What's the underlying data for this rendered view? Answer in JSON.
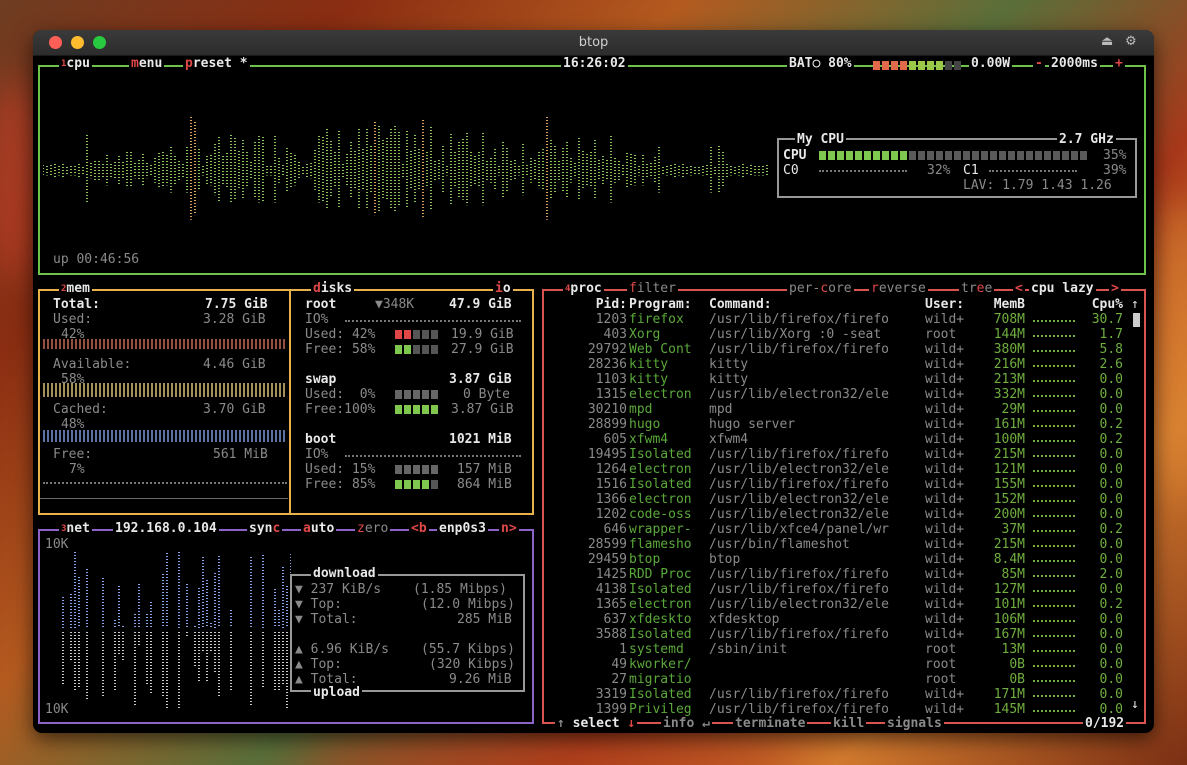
{
  "window": {
    "title": "btop"
  },
  "cpu": {
    "tab": "cpu",
    "tab_num": "1",
    "menu": "menu",
    "preset": "preset *",
    "clock": "16:26:02",
    "battery_label": "BAT○ 80%",
    "battery_level": 0.8,
    "power": "0.00W",
    "minus": "-",
    "interval": "2000ms",
    "plus": "+",
    "uptime": "up 00:46:56",
    "panel_title": "My CPU",
    "freq": "2.7 GHz",
    "total_label": "CPU",
    "total_pct": "35%",
    "total_level": 0.35,
    "c0_label": "C0",
    "c0_pct": "32%",
    "c1_label": "C1",
    "c1_pct": "39%",
    "lav": "LAV: 1.79 1.43 1.26"
  },
  "mem": {
    "tab": "mem",
    "tab_num": "2",
    "total_label": "Total:",
    "total": "7.75 GiB",
    "used_label": "Used:",
    "used": "3.28 GiB",
    "used_pct": "42%",
    "avail_label": "Available:",
    "avail": "4.46 GiB",
    "avail_pct": "58%",
    "cached_label": "Cached:",
    "cached": "3.70 GiB",
    "cached_pct": "48%",
    "free_label": "Free:",
    "free": "561 MiB",
    "free_pct": "7%"
  },
  "disks": {
    "tab": "disks",
    "io_tab": "io",
    "root": {
      "name": "root",
      "io": "▼348K",
      "size": "47.9 GiB",
      "io_label": "IO%",
      "used_label": "Used: 42%",
      "used": "19.9 GiB",
      "free_label": "Free: 58%",
      "free": "27.9 GiB"
    },
    "swap": {
      "name": "swap",
      "size": "3.87 GiB",
      "used_label": "Used:  0%",
      "used": "0 Byte",
      "free_label": "Free:100%",
      "free": "3.87 GiB"
    },
    "boot": {
      "name": "boot",
      "size": "1021 MiB",
      "io_label": "IO%",
      "used_label": "Used: 15%",
      "used": "157 MiB",
      "free_label": "Free: 85%",
      "free": "864 MiB"
    }
  },
  "net": {
    "tab": "net",
    "tab_num": "3",
    "ip": "192.168.0.104",
    "sync": "sync",
    "auto": "auto",
    "zero": "zero",
    "prev": "<b",
    "iface": "enp0s3",
    "next": "n>",
    "scale_top": "10K",
    "scale_bottom": "10K",
    "download": "download",
    "upload": "upload",
    "dl_rate": "▼ 237 KiB/s",
    "dl_rate_bits": "(1.85 Mibps)",
    "dl_top": "▼ Top:",
    "dl_top_val": "(12.0 Mibps)",
    "dl_total": "▼ Total:",
    "dl_total_val": "285 MiB",
    "ul_rate": "▲ 6.96 KiB/s",
    "ul_rate_bits": "(55.7 Kibps)",
    "ul_top": "▲ Top:",
    "ul_top_val": "(320 Kibps)",
    "ul_total": "▲ Total:",
    "ul_total_val": "9.26 MiB"
  },
  "proc": {
    "tab": "proc",
    "tab_num": "4",
    "filter": "filter",
    "per_core": "per-core",
    "reverse": "reverse",
    "tree": "tree",
    "sort_prev": "<",
    "sort": "cpu lazy",
    "sort_next": ">",
    "columns": {
      "pid": "Pid:",
      "program": "Program:",
      "command": "Command:",
      "user": "User:",
      "mem": "MemB",
      "cpu": "Cpu%"
    },
    "rows": [
      {
        "pid": "1203",
        "prog": "firefox",
        "cmd": "/usr/lib/firefox/firefo",
        "user": "wild+",
        "mem": "708M",
        "cpu": "30.7"
      },
      {
        "pid": "403",
        "prog": "Xorg",
        "cmd": "/usr/lib/Xorg :0 -seat",
        "user": "root",
        "mem": "144M",
        "cpu": "1.7"
      },
      {
        "pid": "29792",
        "prog": "Web Cont",
        "cmd": "/usr/lib/firefox/firefo",
        "user": "wild+",
        "mem": "380M",
        "cpu": "5.8"
      },
      {
        "pid": "28236",
        "prog": "kitty",
        "cmd": "kitty",
        "user": "wild+",
        "mem": "216M",
        "cpu": "2.6"
      },
      {
        "pid": "1103",
        "prog": "kitty",
        "cmd": "kitty",
        "user": "wild+",
        "mem": "213M",
        "cpu": "0.0"
      },
      {
        "pid": "1315",
        "prog": "electron",
        "cmd": "/usr/lib/electron32/ele",
        "user": "wild+",
        "mem": "332M",
        "cpu": "0.0"
      },
      {
        "pid": "30210",
        "prog": "mpd",
        "cmd": "mpd",
        "user": "wild+",
        "mem": "29M",
        "cpu": "0.0"
      },
      {
        "pid": "28899",
        "prog": "hugo",
        "cmd": "hugo server",
        "user": "wild+",
        "mem": "161M",
        "cpu": "0.2"
      },
      {
        "pid": "605",
        "prog": "xfwm4",
        "cmd": "xfwm4",
        "user": "wild+",
        "mem": "100M",
        "cpu": "0.2"
      },
      {
        "pid": "19495",
        "prog": "Isolated",
        "cmd": "/usr/lib/firefox/firefo",
        "user": "wild+",
        "mem": "215M",
        "cpu": "0.0"
      },
      {
        "pid": "1264",
        "prog": "electron",
        "cmd": "/usr/lib/electron32/ele",
        "user": "wild+",
        "mem": "121M",
        "cpu": "0.0"
      },
      {
        "pid": "1516",
        "prog": "Isolated",
        "cmd": "/usr/lib/firefox/firefo",
        "user": "wild+",
        "mem": "155M",
        "cpu": "0.0"
      },
      {
        "pid": "1366",
        "prog": "electron",
        "cmd": "/usr/lib/electron32/ele",
        "user": "wild+",
        "mem": "152M",
        "cpu": "0.0"
      },
      {
        "pid": "1202",
        "prog": "code-oss",
        "cmd": "/usr/lib/electron32/ele",
        "user": "wild+",
        "mem": "200M",
        "cpu": "0.0"
      },
      {
        "pid": "646",
        "prog": "wrapper-",
        "cmd": "/usr/lib/xfce4/panel/wr",
        "user": "wild+",
        "mem": "37M",
        "cpu": "0.2"
      },
      {
        "pid": "28599",
        "prog": "flamesho",
        "cmd": "/usr/bin/flameshot",
        "user": "wild+",
        "mem": "215M",
        "cpu": "0.0"
      },
      {
        "pid": "29459",
        "prog": "btop",
        "cmd": "btop",
        "user": "wild+",
        "mem": "8.4M",
        "cpu": "0.0"
      },
      {
        "pid": "1425",
        "prog": "RDD Proc",
        "cmd": "/usr/lib/firefox/firefo",
        "user": "wild+",
        "mem": "85M",
        "cpu": "2.0"
      },
      {
        "pid": "4138",
        "prog": "Isolated",
        "cmd": "/usr/lib/firefox/firefo",
        "user": "wild+",
        "mem": "127M",
        "cpu": "0.0"
      },
      {
        "pid": "1365",
        "prog": "electron",
        "cmd": "/usr/lib/electron32/ele",
        "user": "wild+",
        "mem": "101M",
        "cpu": "0.2"
      },
      {
        "pid": "637",
        "prog": "xfdeskto",
        "cmd": "xfdesktop",
        "user": "wild+",
        "mem": "106M",
        "cpu": "0.0"
      },
      {
        "pid": "3588",
        "prog": "Isolated",
        "cmd": "/usr/lib/firefox/firefo",
        "user": "wild+",
        "mem": "167M",
        "cpu": "0.0"
      },
      {
        "pid": "1",
        "prog": "systemd",
        "cmd": "/sbin/init",
        "user": "root",
        "mem": "13M",
        "cpu": "0.0"
      },
      {
        "pid": "49",
        "prog": "kworker/",
        "cmd": "",
        "user": "root",
        "mem": "0B",
        "cpu": "0.0"
      },
      {
        "pid": "27",
        "prog": "migratio",
        "cmd": "",
        "user": "root",
        "mem": "0B",
        "cpu": "0.0"
      },
      {
        "pid": "3319",
        "prog": "Isolated",
        "cmd": "/usr/lib/firefox/firefo",
        "user": "wild+",
        "mem": "171M",
        "cpu": "0.0"
      },
      {
        "pid": "1399",
        "prog": "Privileg",
        "cmd": "/usr/lib/firefox/firefo",
        "user": "wild+",
        "mem": "145M",
        "cpu": "0.0"
      }
    ],
    "select": "↑ select ↓",
    "info": "info ↵",
    "terminate": "terminate",
    "kill": "kill",
    "signals": "signals",
    "count": "0/192"
  },
  "colors": {
    "cpu_border": "#6cc24a",
    "mem_border": "#e8b24a",
    "net_border": "#8e63c7",
    "proc_border": "#d9534f",
    "accent": "#e04848",
    "program": "#5aa83a"
  }
}
